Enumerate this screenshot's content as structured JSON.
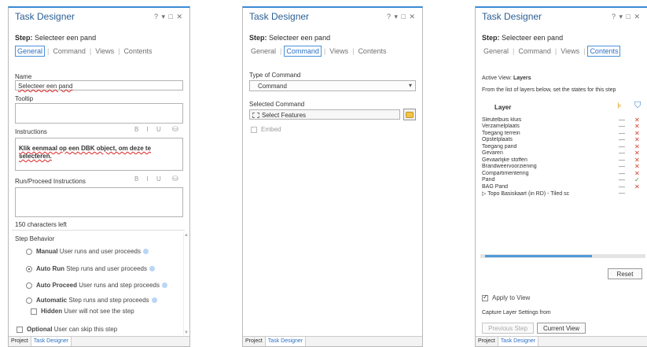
{
  "panels": [
    {
      "title": "Task Designer",
      "window_controls": "? ▾ □ ✕",
      "step_label": "Step:",
      "step_name": "Selecteer een pand",
      "tabs": [
        "General",
        "Command",
        "Views",
        "Contents"
      ],
      "active_tab": "General",
      "name_label": "Name",
      "name_value": "Selecteer een pand",
      "tooltip_label": "Tooltip",
      "tooltip_value": "",
      "instructions_label": "Instructions",
      "instructions_value": "Klik eenmaal op een DBK object, om deze te selecteren.",
      "format_icons": "B I U",
      "run_instructions_label": "Run/Proceed Instructions",
      "run_instructions_value": "",
      "chars_left": "150 characters left",
      "step_behavior_label": "Step Behavior",
      "behaviors": [
        {
          "name": "Manual",
          "desc": "User runs and user proceeds",
          "selected": false
        },
        {
          "name": "Auto Run",
          "desc": "Step runs and user proceeds",
          "selected": true
        },
        {
          "name": "Auto Proceed",
          "desc": "User runs and step proceeds",
          "selected": false
        },
        {
          "name": "Automatic",
          "desc": "Step runs and step proceeds",
          "selected": false
        }
      ],
      "hidden_name": "Hidden",
      "hidden_desc": "User will not see the step",
      "optional_name": "Optional",
      "optional_desc": "User can skip this step",
      "bottom_tabs": [
        "Project",
        "Task Designer"
      ]
    },
    {
      "title": "Task Designer",
      "window_controls": "? ▾ □ ✕",
      "step_label": "Step:",
      "step_name": "Selecteer een pand",
      "tabs": [
        "General",
        "Command",
        "Views",
        "Contents"
      ],
      "active_tab": "Command",
      "type_label": "Type of Command",
      "type_value": "Command",
      "selected_label": "Selected Command",
      "selected_value": "Select Features",
      "embed_label": "Embed",
      "bottom_tabs": [
        "Project",
        "Task Designer"
      ]
    },
    {
      "title": "Task Designer",
      "window_controls": "? ▾ □ ✕",
      "step_label": "Step:",
      "step_name": "Selecteer een pand",
      "tabs": [
        "General",
        "Command",
        "Views",
        "Contents"
      ],
      "active_tab": "Contents",
      "active_view_label": "Active View:",
      "active_view_value": "Layers",
      "hint": "From the list of layers below, set the states for this step",
      "layer_header": "Layer",
      "layers": [
        {
          "name": "Sleutelbuis kluis",
          "vis": "—",
          "sel": "✕"
        },
        {
          "name": "Verzamelplaats",
          "vis": "—",
          "sel": "✕"
        },
        {
          "name": "Toegang terrein",
          "vis": "—",
          "sel": "✕"
        },
        {
          "name": "Opstelplaats",
          "vis": "—",
          "sel": "✕"
        },
        {
          "name": "Toegang pand",
          "vis": "—",
          "sel": "✕"
        },
        {
          "name": "Gevaren",
          "vis": "—",
          "sel": "✕"
        },
        {
          "name": "Gevaarlijke stoffen",
          "vis": "—",
          "sel": "✕"
        },
        {
          "name": "Brandweervoorziening",
          "vis": "—",
          "sel": "✕"
        },
        {
          "name": "Compartimentering",
          "vis": "—",
          "sel": "✕"
        },
        {
          "name": "Pand",
          "vis": "—",
          "sel": "✓"
        },
        {
          "name": "BAG Pand",
          "vis": "—",
          "sel": "✕"
        },
        {
          "name": "▷ Topo Basiskaart (in RD) - Tiled sc",
          "vis": "—",
          "sel": ""
        }
      ],
      "reset_label": "Reset",
      "apply_label": "Apply to View",
      "capture_label": "Capture Layer Settings from",
      "prev_btn": "Previous Step",
      "current_btn": "Current View",
      "bottom_tabs": [
        "Project",
        "Task Designer"
      ]
    }
  ]
}
